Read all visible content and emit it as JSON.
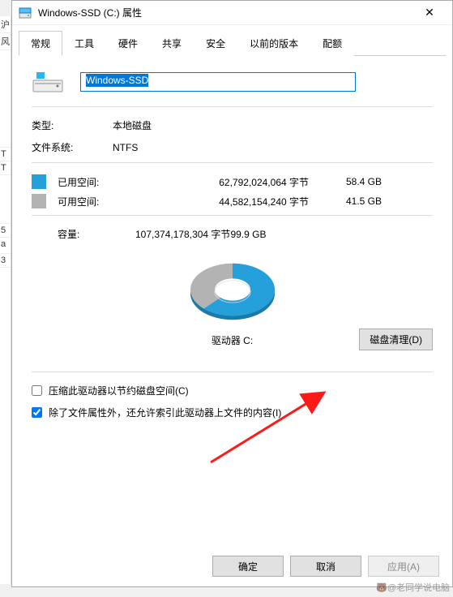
{
  "window": {
    "title": "Windows-SSD (C:) 属性",
    "close": "✕"
  },
  "tabs": [
    "常规",
    "工具",
    "硬件",
    "共享",
    "安全",
    "以前的版本",
    "配额"
  ],
  "drive_name": "Windows-SSD",
  "rows": {
    "type_label": "类型:",
    "type_value": "本地磁盘",
    "fs_label": "文件系统:",
    "fs_value": "NTFS"
  },
  "space": {
    "used_label": "已用空间:",
    "used_bytes": "62,792,024,064 字节",
    "used_gb": "58.4 GB",
    "free_label": "可用空间:",
    "free_bytes": "44,582,154,240 字节",
    "free_gb": "41.5 GB",
    "cap_label": "容量:",
    "cap_bytes": "107,374,178,304 字节",
    "cap_gb": "99.9 GB"
  },
  "drive_letter_label": "驱动器 C:",
  "cleanup_button": "磁盘清理(D)",
  "checkbox1": "压缩此驱动器以节约磁盘空间(C)",
  "checkbox2": "除了文件属性外，还允许索引此驱动器上文件的内容(I)",
  "buttons": {
    "ok": "确定",
    "cancel": "取消",
    "apply": "应用(A)"
  },
  "colors": {
    "used": "#26a0da",
    "free": "#b3b3b3"
  },
  "chart_data": {
    "type": "pie",
    "title": "驱动器 C:",
    "categories": [
      "已用空间",
      "可用空间"
    ],
    "values": [
      58.4,
      41.5
    ],
    "series_colors": [
      "#26a0da",
      "#b3b3b3"
    ]
  },
  "watermark": "🐻@老同学说电脑",
  "left_fragments": [
    "沪",
    "风",
    "",
    "T",
    "T",
    "",
    "5",
    "a",
    "3"
  ]
}
